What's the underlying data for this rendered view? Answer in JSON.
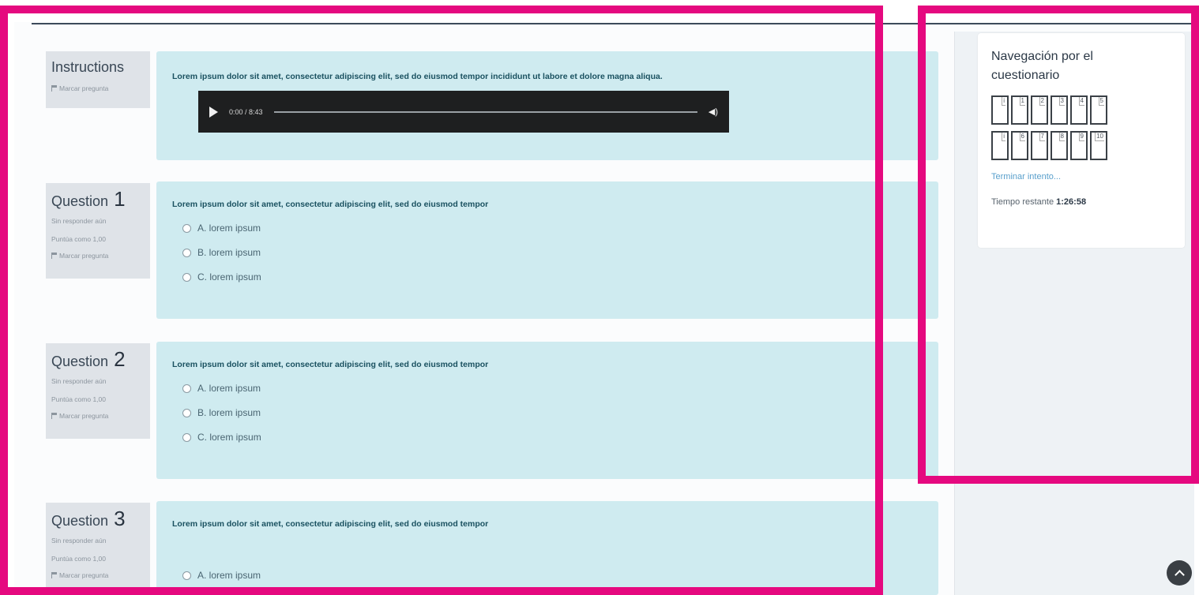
{
  "instructions": {
    "title": "Instructions",
    "flag_label": "Marcar pregunta",
    "text": "Lorem ipsum dolor sit amet, consectetur adipiscing elit, sed do eiusmod tempor incididunt ut labore et dolore magna aliqua.",
    "audio_time": "0:00 / 8:43"
  },
  "questions": [
    {
      "label": "Question",
      "number": "1",
      "status": "Sin responder aún",
      "score": "Puntúa como 1,00",
      "flag_label": "Marcar pregunta",
      "text": "Lorem ipsum dolor sit amet, consectetur adipiscing elit, sed do eiusmod tempor",
      "options": [
        "A. lorem ipsum",
        "B. lorem ipsum",
        "C. lorem ipsum"
      ]
    },
    {
      "label": "Question",
      "number": "2",
      "status": "Sin responder aún",
      "score": "Puntúa como 1,00",
      "flag_label": "Marcar pregunta",
      "text": "Lorem ipsum dolor sit amet, consectetur adipiscing elit, sed do eiusmod tempor",
      "options": [
        "A. lorem ipsum",
        "B. lorem ipsum",
        "C. lorem ipsum"
      ]
    },
    {
      "label": "Question",
      "number": "3",
      "status": "Sin responder aún",
      "score": "Puntúa como 1,00",
      "flag_label": "Marcar pregunta",
      "text": "Lorem ipsum dolor sit amet, consectetur adipiscing elit, sed do eiusmod tempor",
      "options": [
        "A. lorem ipsum"
      ]
    }
  ],
  "navigation": {
    "title": "Navegación por el cuestionario",
    "buttons": [
      "i",
      "1",
      "2",
      "3",
      "4",
      "5",
      "i",
      "6",
      "7",
      "8",
      "9",
      "10"
    ],
    "finish_link": "Terminar intento...",
    "time_label": "Tiempo restante",
    "time_value": "1:26:58"
  },
  "colors": {
    "highlight": "#e5097f",
    "question_bg": "#cfebf0",
    "info_bg": "#dfe3e8",
    "link": "#5aa0cc"
  }
}
